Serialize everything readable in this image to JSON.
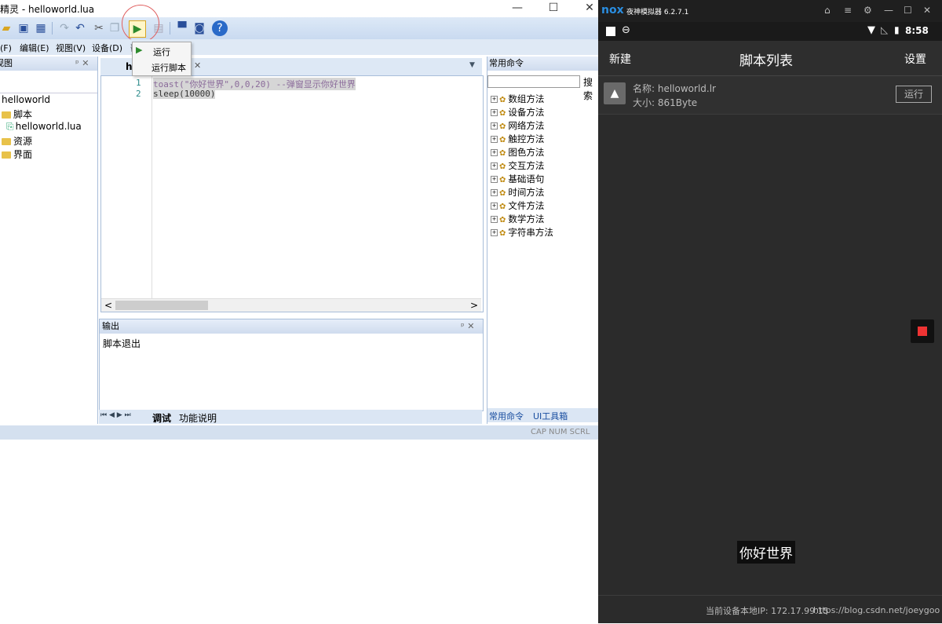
{
  "ide": {
    "title": "触动精灵 - helloworld.lua",
    "window_buttons": [
      "—",
      "☐",
      "✕"
    ],
    "menu": [
      "文件(F)",
      "编辑(E)",
      "视图(V)",
      "设备(D)",
      "帮"
    ],
    "run_menu": {
      "item1": "运行",
      "item2": "运行脚本"
    },
    "project_panel": {
      "title": "视图",
      "pin_close": "ᵖ ✕",
      "root": "helloworld",
      "items": [
        "脚本",
        "helloworld.lua",
        "资源",
        "界面"
      ]
    },
    "editor": {
      "tab": "h",
      "tab_close": "✕",
      "dropdown": "▼",
      "lines": [
        {
          "num": "1",
          "code": "toast(\"你好世界\",0,0,20) --弹窗显示你好世界"
        },
        {
          "num": "2",
          "code": "sleep(10000)"
        }
      ],
      "scroll_left": "<",
      "scroll_right": ">"
    },
    "output": {
      "title": "输出",
      "pin_close": "ᵖ ✕",
      "text": "脚本退出"
    },
    "bottom_tabs": {
      "nav": "⏮ ◀ ▶ ⏭",
      "tab1": "调试",
      "tab2": "功能说明"
    },
    "commands": {
      "title": "常用命令",
      "search_button": "搜索",
      "items": [
        "数组方法",
        "设备方法",
        "网络方法",
        "触控方法",
        "图色方法",
        "交互方法",
        "基础语句",
        "时间方法",
        "文件方法",
        "数学方法",
        "字符串方法"
      ],
      "tab1": "常用命令",
      "tab2": "UI工具箱"
    },
    "status": "CAP NUM SCRL"
  },
  "emulator": {
    "title": "夜神模拟器 6.2.7.1",
    "logo": "nox",
    "window_icons": [
      "⌂",
      "≡",
      "⚙",
      "—",
      "☐",
      "✕"
    ],
    "time": "8:58",
    "appbar": {
      "left": "新建",
      "title": "脚本列表",
      "right": "设置"
    },
    "script": {
      "name": "名称: helloworld.lr",
      "size": "大小: 861Byte",
      "run": "运行"
    },
    "toast": "你好世界",
    "footer": "当前设备本地IP: 172.17.99.15",
    "watermark": "https://blog.csdn.net/joeygoo"
  }
}
